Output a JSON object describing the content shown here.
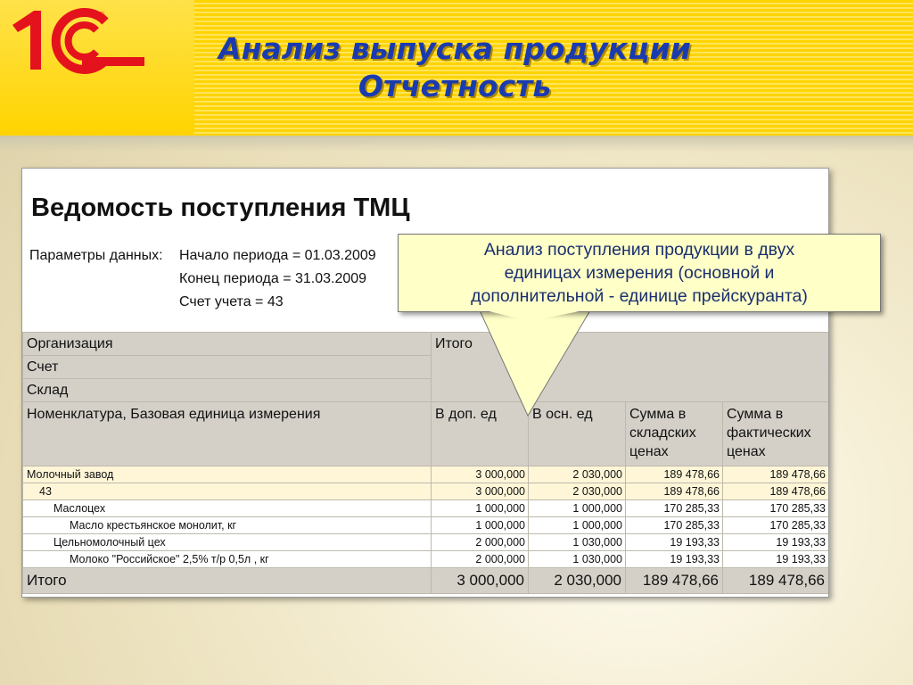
{
  "slide": {
    "title_line1": "Анализ выпуска продукции",
    "title_line2": "Отчетность",
    "logo_text": "1С",
    "logo_mark": "®"
  },
  "report": {
    "title": "Ведомость поступления ТМЦ",
    "params_label": "Параметры данных:",
    "params": [
      "Начало периода = 01.03.2009",
      "Конец периода = 31.03.2009",
      "Счет учета = 43"
    ],
    "header": {
      "org": "Организация",
      "account": "Счет",
      "warehouse": "Склад",
      "total_group": "Итого",
      "nomenclature": "Номенклатура, Базовая единица измерения",
      "col1": "В доп. ед",
      "col2": "В осн. ед",
      "col3": "Сумма в складских ценах",
      "col4": "Сумма в фактических ценах"
    },
    "rows": [
      {
        "name": "Молочный завод",
        "v1": "3 000,000",
        "v2": "2 030,000",
        "v3": "189 478,66",
        "v4": "189 478,66"
      },
      {
        "name": "43",
        "v1": "3 000,000",
        "v2": "2 030,000",
        "v3": "189 478,66",
        "v4": "189 478,66"
      },
      {
        "name": "Маслоцех",
        "v1": "1 000,000",
        "v2": "1 000,000",
        "v3": "170 285,33",
        "v4": "170 285,33"
      },
      {
        "name": "Масло крестьянское монолит, кг",
        "v1": "1 000,000",
        "v2": "1 000,000",
        "v3": "170 285,33",
        "v4": "170 285,33"
      },
      {
        "name": "Цельномолочный цех",
        "v1": "2 000,000",
        "v2": "1 030,000",
        "v3": "19 193,33",
        "v4": "19 193,33"
      },
      {
        "name": "Молоко \"Российское\" 2,5% т/р 0,5л , кг",
        "v1": "2 000,000",
        "v2": "1 030,000",
        "v3": "19 193,33",
        "v4": "19 193,33"
      }
    ],
    "total": {
      "label": "Итого",
      "v1": "3 000,000",
      "v2": "2 030,000",
      "v3": "189 478,66",
      "v4": "189 478,66"
    }
  },
  "callout": {
    "line1": "Анализ поступления продукции в двух",
    "line2": "единицах измерения (основной и",
    "line3": "дополнительной - единице прейскуранта)"
  },
  "colors": {
    "header_yellow": "#ffd400",
    "title_blue": "#1a3bb0",
    "logo_red": "#e4121c",
    "table_header_gray": "#d4d0c8",
    "callout_fill": "#ffffc8"
  }
}
